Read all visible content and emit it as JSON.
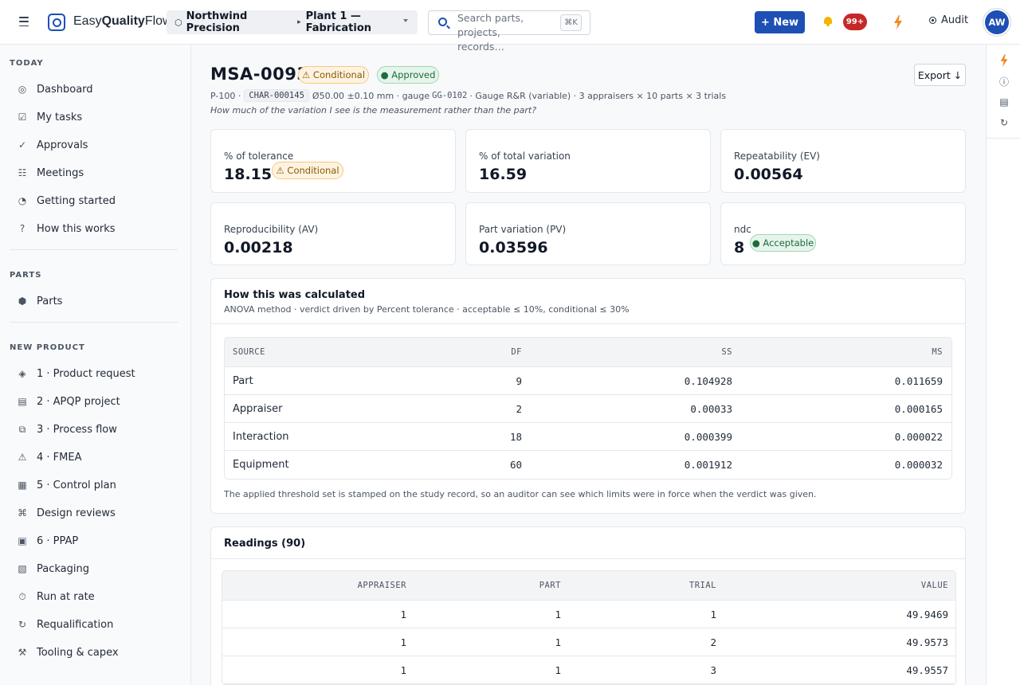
{
  "topbar": {
    "logo_prefix": "Easy",
    "logo_bold": "Quality",
    "logo_suffix": "Flow",
    "company": "Northwind Precision",
    "plant": "Plant 1 — Fabrication",
    "search_placeholder": "Search parts, projects, records…",
    "search_shortcut": "⌘K",
    "new_label": "+ New",
    "notifications": "99+",
    "audit_label": "Audit",
    "avatar_initials": "AW",
    "brand_color": "#1e4fb5"
  },
  "sidebar": {
    "today_label": "TODAY",
    "today_items": [
      {
        "icon": "dashboard-icon",
        "glyph": "◎",
        "label": "Dashboard"
      },
      {
        "icon": "tasks-icon",
        "glyph": "☑",
        "label": "My tasks"
      },
      {
        "icon": "check-icon",
        "glyph": "✓",
        "label": "Approvals"
      },
      {
        "icon": "meetings-icon",
        "glyph": "☷",
        "label": "Meetings"
      },
      {
        "icon": "progress-icon",
        "glyph": "◔",
        "label": "Getting started"
      },
      {
        "icon": "help-icon",
        "glyph": "?",
        "label": "How this works"
      }
    ],
    "parts_label": "PARTS",
    "parts_items": [
      {
        "icon": "part-icon",
        "glyph": "⬢",
        "label": "Parts"
      }
    ],
    "new_product_label": "NEW PRODUCT",
    "new_product_items": [
      {
        "icon": "diamond-icon",
        "glyph": "◈",
        "label": "1 · Product request"
      },
      {
        "icon": "project-icon",
        "glyph": "▤",
        "label": "2 · APQP project"
      },
      {
        "icon": "flow-icon",
        "glyph": "⧉",
        "label": "3 · Process flow"
      },
      {
        "icon": "warning-icon",
        "glyph": "⚠",
        "label": "4 · FMEA"
      },
      {
        "icon": "grid-icon",
        "glyph": "▦",
        "label": "5 · Control plan"
      },
      {
        "icon": "review-icon",
        "glyph": "⌘",
        "label": "Design reviews"
      },
      {
        "icon": "ppap-icon",
        "glyph": "▣",
        "label": "6 · PPAP"
      },
      {
        "icon": "packaging-icon",
        "glyph": "▧",
        "label": "Packaging"
      },
      {
        "icon": "timer-icon",
        "glyph": "⏱",
        "label": "Run at rate"
      },
      {
        "icon": "refresh-icon",
        "glyph": "↻",
        "label": "Requalification"
      },
      {
        "icon": "tools-icon",
        "glyph": "⚒",
        "label": "Tooling & capex"
      }
    ]
  },
  "study": {
    "id": "MSA-0093",
    "status_verdict": "⚠ Conditional",
    "status_approval": "● Approved",
    "export_label": "Export ↓",
    "meta_part": "P-100 ·",
    "meta_char": "CHAR-000145",
    "meta_rest_1": "Ø50.00 ±0.10 mm · gauge",
    "meta_gauge": "GG-0102",
    "meta_rest_2": "· Gauge R&R (variable) · 3 appraisers × 10 parts × 3 trials",
    "question": "How much of the variation I see is the measurement rather than the part?"
  },
  "metrics": [
    {
      "label": "% of tolerance",
      "value": "18.15",
      "badge": "⚠ Conditional",
      "badge_type": "warn"
    },
    {
      "label": "% of total variation",
      "value": "16.59"
    },
    {
      "label": "Repeatability (EV)",
      "value": "0.00564"
    },
    {
      "label": "Reproducibility (AV)",
      "value": "0.00218"
    },
    {
      "label": "Part variation (PV)",
      "value": "0.03596"
    },
    {
      "label": "ndc",
      "value": "8",
      "badge": "● Acceptable",
      "badge_type": "ok"
    }
  ],
  "calculation": {
    "title": "How this was calculated",
    "subtitle": "ANOVA method · verdict driven by Percent tolerance · acceptable ≤ 10%, conditional ≤ 30%",
    "columns": [
      "SOURCE",
      "DF",
      "SS",
      "MS"
    ],
    "rows": [
      {
        "source": "Part",
        "df": "9",
        "ss": "0.104928",
        "ms": "0.011659"
      },
      {
        "source": "Appraiser",
        "df": "2",
        "ss": "0.00033",
        "ms": "0.000165"
      },
      {
        "source": "Interaction",
        "df": "18",
        "ss": "0.000399",
        "ms": "0.000022"
      },
      {
        "source": "Equipment",
        "df": "60",
        "ss": "0.001912",
        "ms": "0.000032"
      }
    ],
    "note": "The applied threshold set is stamped on the study record, so an auditor can see which limits were in force when the verdict was given."
  },
  "readings": {
    "title": "Readings (90)",
    "columns": [
      "APPRAISER",
      "PART",
      "TRIAL",
      "VALUE"
    ],
    "rows": [
      {
        "appraiser": "1",
        "part": "1",
        "trial": "1",
        "value": "49.9469"
      },
      {
        "appraiser": "1",
        "part": "1",
        "trial": "2",
        "value": "49.9573"
      },
      {
        "appraiser": "1",
        "part": "1",
        "trial": "3",
        "value": "49.9557"
      }
    ]
  }
}
